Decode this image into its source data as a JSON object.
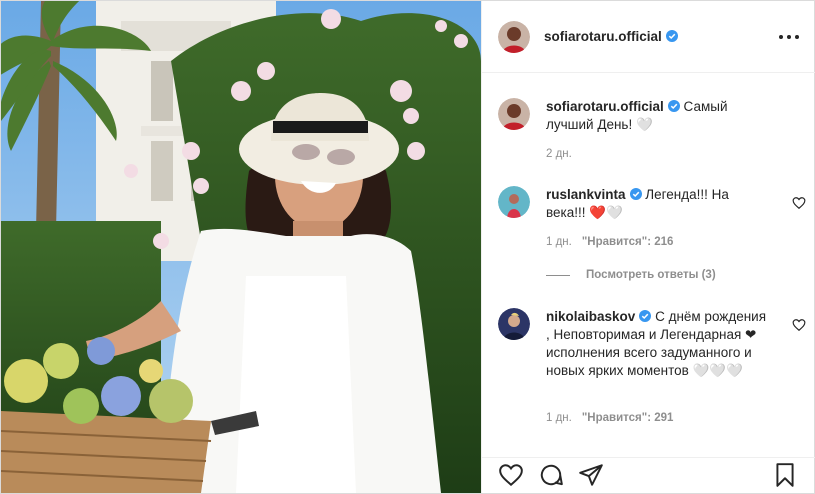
{
  "post": {
    "author": "sofiarotaru.official",
    "more_icon": "more-horizontal-icon"
  },
  "caption": {
    "username": "sofiarotaru.official",
    "text": "Самый лучший День! 🤍",
    "time": "2 дн."
  },
  "comments": [
    {
      "username": "ruslankvinta",
      "text": "Легенда!!! На века!!! ❤️🤍",
      "time": "1 дн.",
      "likes": "\"Нравится\": 216",
      "view_replies": "Посмотреть ответы (3)"
    },
    {
      "username": "nikolaibaskov",
      "text": "С днём рождения , Неповторимая и Легендарная ❤ исполнения всего задуманного и новых ярких моментов 🤍🤍🤍",
      "time": "1 дн.",
      "likes": "\"Нравится\": 291"
    }
  ],
  "actions": {
    "like": "heart-icon",
    "comment": "comment-icon",
    "share": "paper-plane-icon",
    "save": "bookmark-icon"
  },
  "colors": {
    "verified": "#3897f0",
    "text": "#262626",
    "muted": "#8e8e8e",
    "border": "#dbdbdb"
  }
}
